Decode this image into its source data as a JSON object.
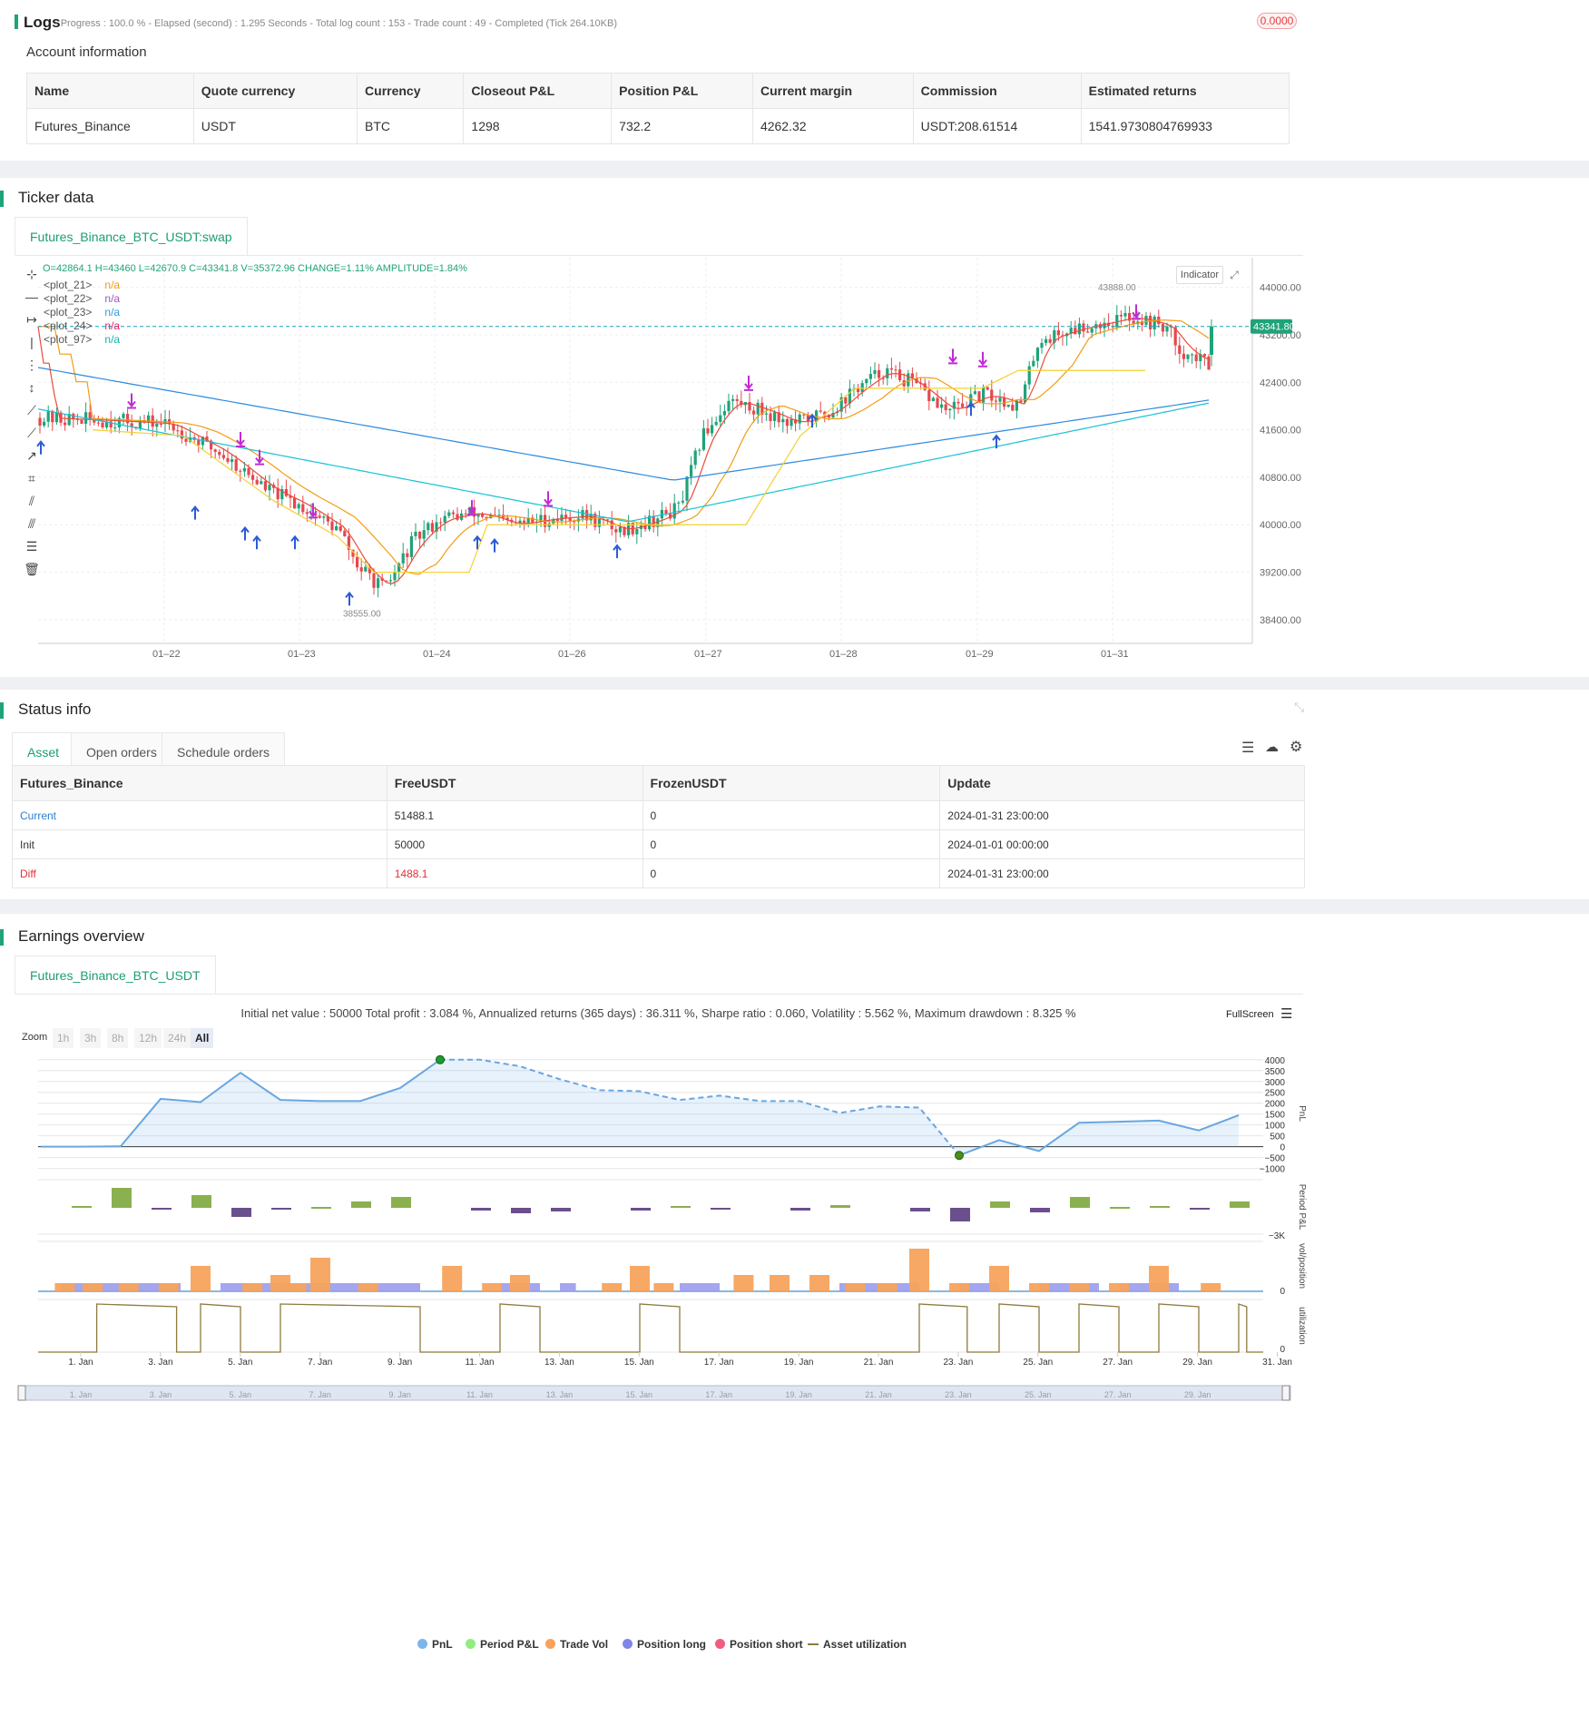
{
  "logs": {
    "title": "Logs",
    "status": "- Progress : 100.0 % - Elapsed (second) : 1.295  Seconds - Total log count : 153 - Trade count : 49 - Completed (Tick 264.10KB)",
    "badge": "0.0000"
  },
  "account": {
    "title": "Account information",
    "headers": [
      "Name",
      "Quote currency",
      "Currency",
      "Closeout P&L",
      "Position P&L",
      "Current margin",
      "Commission",
      "Estimated returns"
    ],
    "row": [
      "Futures_Binance",
      "USDT",
      "BTC",
      "1298",
      "732.2",
      "4262.32",
      "USDT:208.61514",
      "1541.9730804769933"
    ]
  },
  "ticker": {
    "title": "Ticker data",
    "tab": "Futures_Binance_BTC_USDT:swap",
    "ohlc": "O=42864.1 H=43460 L=42670.9 C=43341.8 V=35372.96 CHANGE=1.11% AMPLITUDE=1.84%",
    "legend": [
      {
        "name": "<plot_21>",
        "value": "n/a",
        "color": "#f39c12"
      },
      {
        "name": "<plot_22>",
        "value": "n/a",
        "color": "#9b59b6"
      },
      {
        "name": "<plot_23>",
        "value": "n/a",
        "color": "#2d9cdb"
      },
      {
        "name": "<plot_24>",
        "value": "n/a",
        "color": "#e0245e"
      },
      {
        "name": "<plot_97>",
        "value": "n/a",
        "color": "#17b0a6"
      }
    ],
    "indicator_btn": "Indicator",
    "price_ticks": [
      "44000.00",
      "43200.00",
      "42400.00",
      "41600.00",
      "40800.00",
      "40000.00",
      "39200.00",
      "38400.00"
    ],
    "last_price": "43341.80",
    "date_ticks": [
      "01–22",
      "01–23",
      "01–24",
      "01–26",
      "01–27",
      "01–28",
      "01–29",
      "01–31"
    ],
    "high_label": "43888.00",
    "low_label": "38555.00"
  },
  "status": {
    "title": "Status info",
    "tabs": [
      "Asset",
      "Open orders",
      "Schedule orders"
    ],
    "headers": [
      "Futures_Binance",
      "FreeUSDT",
      "FrozenUSDT",
      "Update"
    ],
    "rows": [
      [
        "Current",
        "51488.1",
        "0",
        "2024-01-31 23:00:00"
      ],
      [
        "Init",
        "50000",
        "0",
        "2024-01-01 00:00:00"
      ],
      [
        "Diff",
        "1488.1",
        "0",
        "2024-01-31 23:00:00"
      ]
    ]
  },
  "earnings": {
    "title": "Earnings overview",
    "tab": "Futures_Binance_BTC_USDT",
    "summary": "Initial net value : 50000 Total profit : 3.084 %, Annualized returns (365 days) : 36.311 %, Sharpe ratio : 0.060, Volatility : 5.562 %, Maximum drawdown : 8.325 %",
    "fullscreen": "FullScreen",
    "zoom_label": "Zoom",
    "zoom_options": [
      "1h",
      "3h",
      "8h",
      "12h",
      "24h",
      "All"
    ],
    "pnl_ticks": [
      "4000",
      "3500",
      "3000",
      "2500",
      "2000",
      "1500",
      "1000",
      "500",
      "0",
      "−500",
      "−1000"
    ],
    "period_tick": "−3K",
    "vol_tick": "0",
    "util_tick": "0",
    "axis_titles": [
      "PnL",
      "Period P&L",
      "vol/position",
      "utilization"
    ],
    "date_ticks": [
      "1. Jan",
      "3. Jan",
      "5. Jan",
      "7. Jan",
      "9. Jan",
      "11. Jan",
      "13. Jan",
      "15. Jan",
      "17. Jan",
      "19. Jan",
      "21. Jan",
      "23. Jan",
      "25. Jan",
      "27. Jan",
      "29. Jan",
      "31. Jan"
    ],
    "legend": [
      {
        "name": "PnL",
        "color": "#7cb5ec"
      },
      {
        "name": "Period P&L",
        "color": "#90ed7d"
      },
      {
        "name": "Trade Vol",
        "color": "#f7a35c"
      },
      {
        "name": "Position long",
        "color": "#8085e9"
      },
      {
        "name": "Position short",
        "color": "#f15c80"
      },
      {
        "name": "Asset utilization",
        "color": "#8d7b3e"
      }
    ]
  }
}
